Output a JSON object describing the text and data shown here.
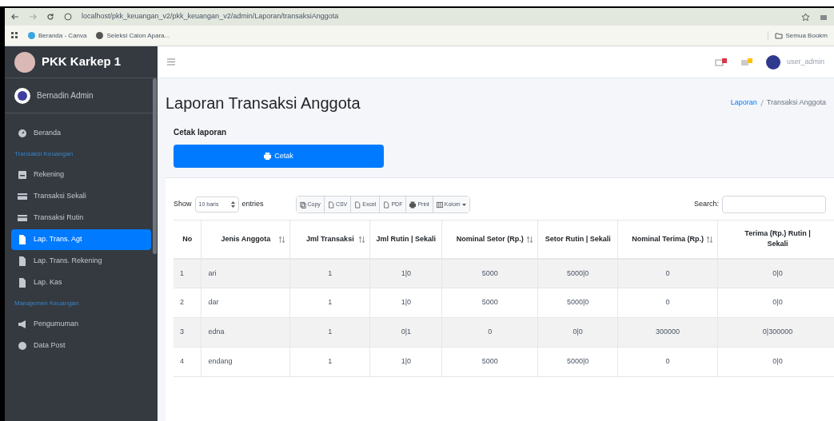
{
  "browser": {
    "url": "localhost/pkk_keuangan_v2/pkk_keuangan_v2/admin/Laporan/transaksiAnggota",
    "bookmarks": [
      "Beranda - Canva",
      "Seleksi Calon Apara..."
    ],
    "all_bookmarks": "Semua Bookm"
  },
  "sidebar": {
    "brand": "PKK Karkep 1",
    "user": "Bernadin Admin",
    "items": [
      {
        "kind": "item",
        "label": "Beranda",
        "selected": false
      },
      {
        "kind": "heading",
        "label": "Transaksi Keuangan"
      },
      {
        "kind": "item",
        "label": "Rekening",
        "selected": false
      },
      {
        "kind": "item",
        "label": "Transaksi Sekali",
        "selected": false
      },
      {
        "kind": "item",
        "label": "Transaksi Rutin",
        "selected": false
      },
      {
        "kind": "item",
        "label": "Lap. Trans. Agt",
        "selected": true
      },
      {
        "kind": "item",
        "label": "Lap. Trans. Rekening",
        "selected": false
      },
      {
        "kind": "item",
        "label": "Lap. Kas",
        "selected": false
      },
      {
        "kind": "heading",
        "label": "Manajemen Keuangan"
      },
      {
        "kind": "item",
        "label": "Pengumuman",
        "selected": false
      },
      {
        "kind": "item",
        "label": "Data Post",
        "selected": false
      }
    ]
  },
  "navbar": {
    "user": "user_admin"
  },
  "page": {
    "title": "Laporan Transaksi Anggota",
    "breadcrumb": [
      "Laporan",
      "Transaksi Anggota"
    ]
  },
  "print_card": {
    "label": "Cetak laporan",
    "button": "Cetak"
  },
  "table_controls": {
    "show": "Show",
    "length": "10 baris",
    "entries": "entries",
    "buttons": [
      "Copy",
      "CSV",
      "Excel",
      "PDF",
      "Print",
      "Kolom"
    ],
    "search": "Search:"
  },
  "table": {
    "columns": [
      {
        "label": "No",
        "sortable": false
      },
      {
        "label": "Jenis Anggota",
        "sortable": true
      },
      {
        "label": "Jml Transaksi",
        "sortable": true
      },
      {
        "label": "Jml Rutin | Sekali",
        "sortable": false
      },
      {
        "label": "Nominal Setor (Rp.)",
        "sortable": true
      },
      {
        "label": "Setor Rutin | Sekali",
        "sortable": false
      },
      {
        "label": "Nominal Terima (Rp.)",
        "sortable": true
      },
      {
        "label": "Terima (Rp.) Rutin | Sekali",
        "sortable": false
      }
    ],
    "rows": [
      [
        "1",
        "ari",
        "1",
        "1|0",
        "5000",
        "5000|0",
        "0",
        "0|0"
      ],
      [
        "2",
        "dar",
        "1",
        "1|0",
        "5000",
        "5000|0",
        "0",
        "0|0"
      ],
      [
        "3",
        "edna",
        "1",
        "0|1",
        "0",
        "0|0",
        "300000",
        "0|300000"
      ],
      [
        "4",
        "endang",
        "1",
        "1|0",
        "5000",
        "5000|0",
        "0",
        "0|0"
      ]
    ]
  }
}
